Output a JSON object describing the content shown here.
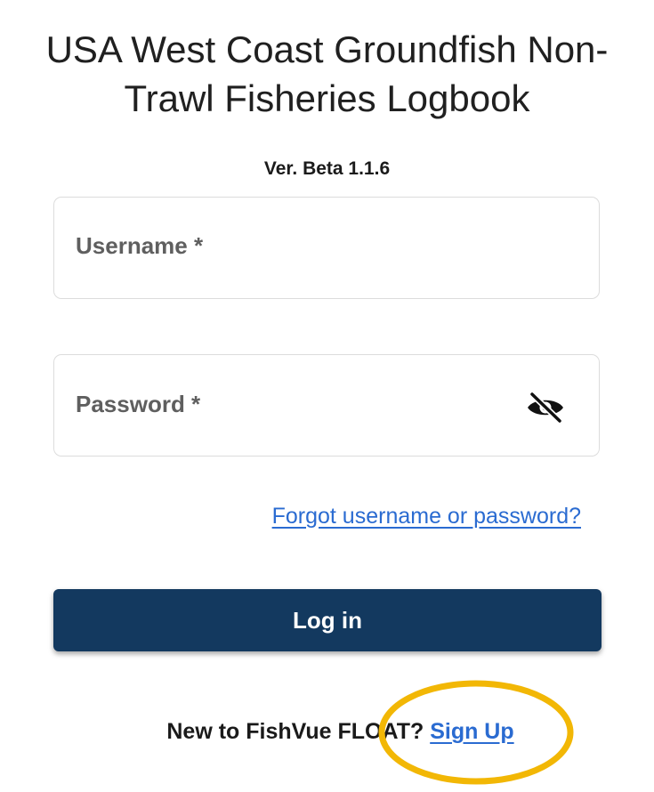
{
  "header": {
    "title_line1": "USA West Coast Groundfish Non-",
    "title_line2": "Trawl Fisheries Logbook",
    "version": "Ver. Beta 1.1.6"
  },
  "form": {
    "username_label": "Username *",
    "password_label": "Password *",
    "password_toggle_icon": "eye-off-icon",
    "forgot_link": "Forgot username or password?",
    "login_button": "Log in"
  },
  "footer": {
    "signup_prompt": "New to FishVue FLOAT?",
    "signup_link": "Sign Up"
  },
  "annotation": {
    "highlight_color": "#f2b705"
  },
  "colors": {
    "primary_button": "#13395f",
    "link": "#2a6bd1"
  }
}
